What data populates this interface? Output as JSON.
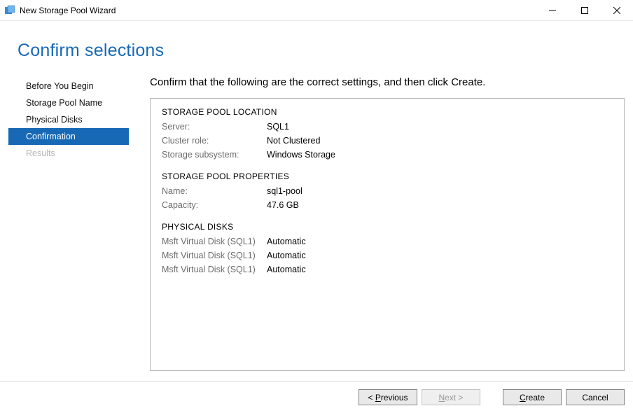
{
  "window": {
    "title": "New Storage Pool Wizard"
  },
  "header": {
    "title": "Confirm selections"
  },
  "sidebar": {
    "items": [
      {
        "label": "Before You Begin",
        "state": "normal"
      },
      {
        "label": "Storage Pool Name",
        "state": "normal"
      },
      {
        "label": "Physical Disks",
        "state": "normal"
      },
      {
        "label": "Confirmation",
        "state": "active"
      },
      {
        "label": "Results",
        "state": "disabled"
      }
    ]
  },
  "main": {
    "instruction": "Confirm that the following are the correct settings, and then click Create.",
    "sections": [
      {
        "heading": "STORAGE POOL LOCATION",
        "rows": [
          {
            "label": "Server:",
            "value": "SQL1"
          },
          {
            "label": "Cluster role:",
            "value": "Not Clustered"
          },
          {
            "label": "Storage subsystem:",
            "value": "Windows Storage"
          }
        ]
      },
      {
        "heading": "STORAGE POOL PROPERTIES",
        "rows": [
          {
            "label": "Name:",
            "value": "sql1-pool"
          },
          {
            "label": "Capacity:",
            "value": "47.6 GB"
          }
        ]
      },
      {
        "heading": "PHYSICAL DISKS",
        "rows": [
          {
            "label": "Msft Virtual Disk (SQL1)",
            "value": "Automatic"
          },
          {
            "label": "Msft Virtual Disk (SQL1)",
            "value": "Automatic"
          },
          {
            "label": "Msft Virtual Disk (SQL1)",
            "value": "Automatic"
          }
        ]
      }
    ]
  },
  "footer": {
    "previous": "< Previous",
    "next": "Next >",
    "create": "Create",
    "cancel": "Cancel",
    "next_enabled": false
  }
}
